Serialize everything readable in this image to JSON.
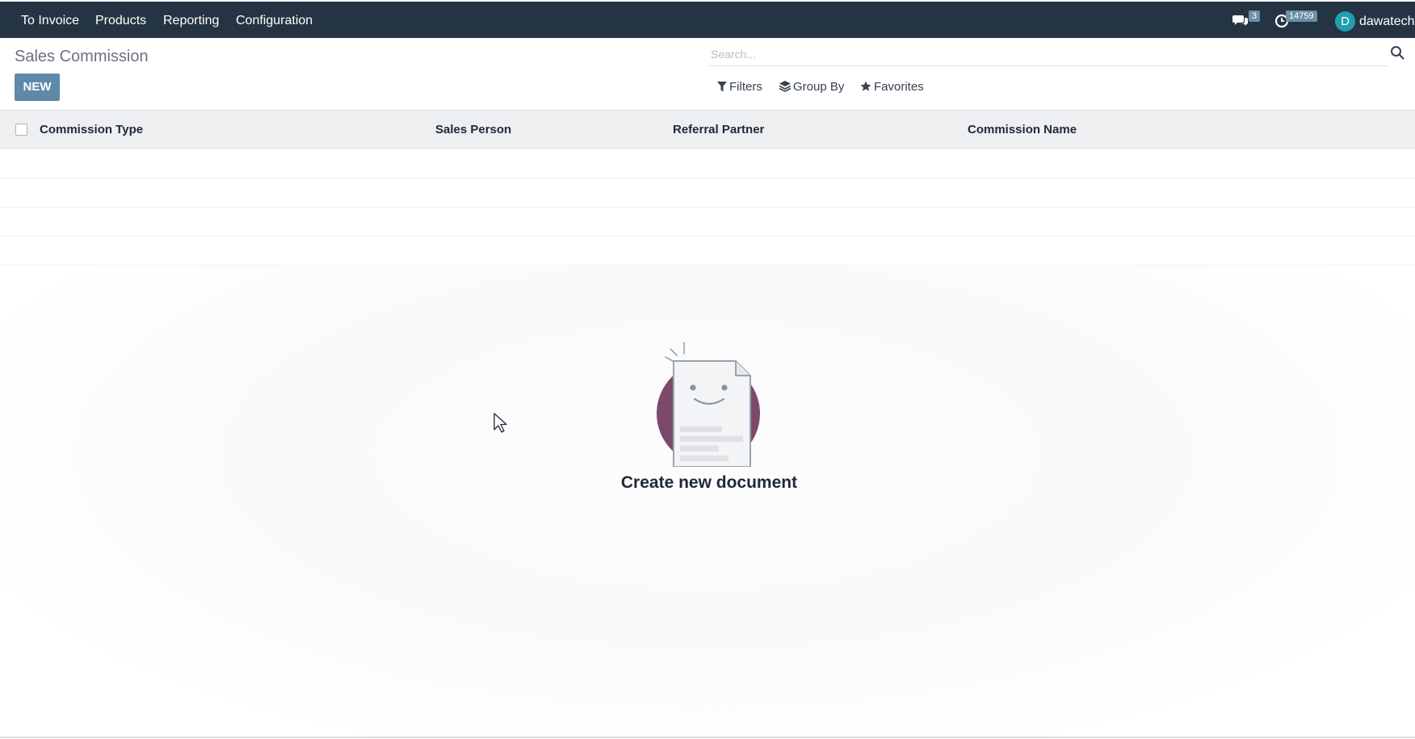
{
  "topbar": {
    "menu": [
      "To Invoice",
      "Products",
      "Reporting",
      "Configuration"
    ],
    "messages_count": "3",
    "activities_count": "14759",
    "avatar_letter": "D",
    "username": "dawatech"
  },
  "page": {
    "title": "Sales Commission",
    "new_label": "NEW"
  },
  "search": {
    "placeholder": "Search..."
  },
  "toolbar": {
    "filters": "Filters",
    "group_by": "Group By",
    "favorites": "Favorites"
  },
  "list": {
    "columns": [
      "Commission Type",
      "Sales Person",
      "Referral Partner",
      "Commission Name"
    ]
  },
  "helper": {
    "title": "Create new document"
  },
  "colors": {
    "navbar": "#243442",
    "primary_button": "#5e8aa8",
    "avatar": "#1f9fb1",
    "illustration_circle": "#7b4a6a"
  },
  "icons": {
    "messages": "chat-bubbles-icon",
    "activities": "clock-icon",
    "search": "search-icon",
    "filters": "filter-icon",
    "group_by": "layers-icon",
    "favorites": "star-icon"
  }
}
